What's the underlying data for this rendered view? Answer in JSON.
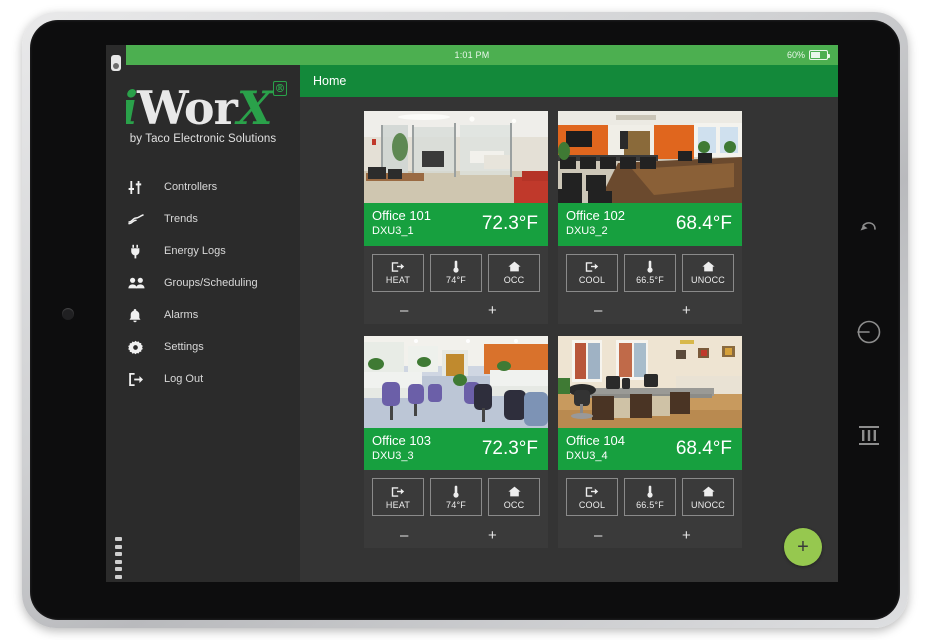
{
  "status_bar": {
    "time": "1:01 PM",
    "battery_percent": "60%"
  },
  "brand": {
    "logo_i": "i",
    "logo_w": "W",
    "logo_o": "o",
    "logo_r": "r",
    "logo_x": "X",
    "registered": "®",
    "tagline": "by Taco Electronic Solutions"
  },
  "sidebar": {
    "items": [
      {
        "label": "Controllers",
        "icon": "sliders-icon"
      },
      {
        "label": "Trends",
        "icon": "trend-line-icon"
      },
      {
        "label": "Energy Logs",
        "icon": "power-plug-icon"
      },
      {
        "label": "Groups/Scheduling",
        "icon": "people-icon"
      },
      {
        "label": "Alarms",
        "icon": "bell-icon"
      },
      {
        "label": "Settings",
        "icon": "gear-icon"
      },
      {
        "label": "Log Out",
        "icon": "logout-icon"
      }
    ]
  },
  "topbar": {
    "title": "Home"
  },
  "cards": [
    {
      "name": "Office 101",
      "device_id": "DXU3_1",
      "temperature": "72.3°F",
      "mode_label": "HEAT",
      "setpoint_label": "74°F",
      "occupancy_label": "OCC",
      "minus": "–",
      "plus": "+",
      "photo": "office-lobby-glass-partitions"
    },
    {
      "name": "Office 102",
      "device_id": "DXU3_2",
      "temperature": "68.4°F",
      "mode_label": "COOL",
      "setpoint_label": "66.5°F",
      "occupancy_label": "UNOCC",
      "minus": "–",
      "plus": "+",
      "photo": "conference-room-orange-wall"
    },
    {
      "name": "Office 103",
      "device_id": "DXU3_3",
      "temperature": "72.3°F",
      "mode_label": "HEAT",
      "setpoint_label": "74°F",
      "occupancy_label": "OCC",
      "minus": "–",
      "plus": "+",
      "photo": "open-plan-cubicles-purple-chairs"
    },
    {
      "name": "Office 104",
      "device_id": "DXU3_4",
      "temperature": "68.4°F",
      "mode_label": "COOL",
      "setpoint_label": "66.5°F",
      "occupancy_label": "UNOCC",
      "minus": "–",
      "plus": "+",
      "photo": "private-office-wood-desks"
    }
  ],
  "fab": {
    "label": "+"
  },
  "device_nav": {
    "icons": [
      "back-arrow-icon",
      "power-icon",
      "recents-icon"
    ]
  },
  "colors": {
    "status_bar_green": "#4caf50",
    "topbar_green": "#13893a",
    "card_header_green": "#17a03f",
    "brand_green": "#2aa14a",
    "fab_green": "#96c84f",
    "sidebar_bg": "#2b2b2b",
    "content_bg": "#343434",
    "card_bg": "#3a3a3a"
  }
}
